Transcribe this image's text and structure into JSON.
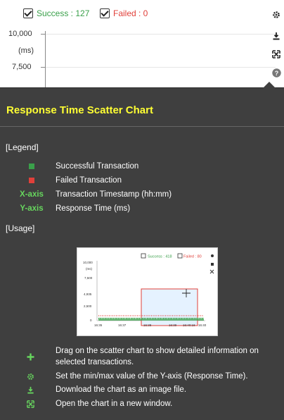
{
  "filters": {
    "success_label": "Success : 127",
    "failed_label": "Failed : 0"
  },
  "axis": {
    "y_tick_top": "10,000",
    "y_unit": "(ms)",
    "y_tick_mid": "7,500"
  },
  "help": {
    "title": "Response Time Scatter Chart",
    "legend_header": "[Legend]",
    "legend": [
      {
        "label": "Successful Transaction",
        "color": "#3aa04a"
      },
      {
        "label": "Failed Transaction",
        "color": "#e0403a"
      },
      {
        "key": "X-axis",
        "label": "Transaction Timestamp (hh:mm)"
      },
      {
        "key": "Y-axis",
        "label": "Response Time (ms)"
      }
    ],
    "usage_header": "[Usage]",
    "usage": [
      {
        "icon": "plus-icon",
        "text": "Drag on the scatter chart to show detailed information on selected transactions."
      },
      {
        "icon": "gear-icon",
        "text": "Set the min/max value of the Y-axis (Response Time)."
      },
      {
        "icon": "download-icon",
        "text": "Download the chart as an image file."
      },
      {
        "icon": "expand-icon",
        "text": "Open the chart in a new window."
      }
    ]
  },
  "thumbnail": {
    "success_label": "Success : 418",
    "failed_label": "Failed : 80",
    "y_ticks": [
      "10,000",
      "(ms)",
      "7,500",
      "4,935",
      "2,500",
      "0"
    ],
    "x_ticks": [
      "16:35",
      "16:37",
      "16:38",
      "16:39",
      "16:40:18",
      "16:40"
    ]
  },
  "colors": {
    "accent_yellow": "#ffff33",
    "axis_key_green": "#67d65e",
    "success_green": "#3aa04a",
    "failed_red": "#e0403a",
    "overlay_bg": "#3f3f3f"
  }
}
